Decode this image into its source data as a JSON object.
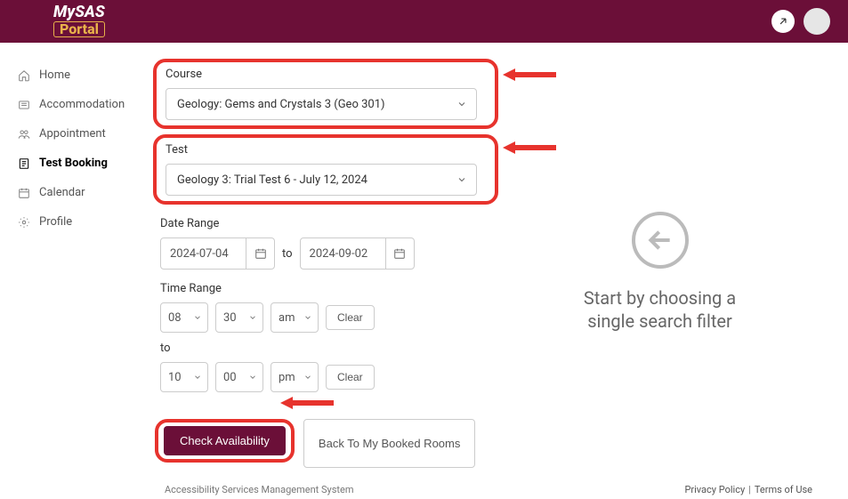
{
  "header": {
    "logo_top": "MySAS",
    "logo_bottom": "Portal"
  },
  "sidebar": {
    "items": [
      {
        "label": "Home",
        "icon": "home-icon"
      },
      {
        "label": "Accommodation",
        "icon": "accommodation-icon"
      },
      {
        "label": "Appointment",
        "icon": "appointment-icon"
      },
      {
        "label": "Test Booking",
        "icon": "test-booking-icon"
      },
      {
        "label": "Calendar",
        "icon": "calendar-icon"
      },
      {
        "label": "Profile",
        "icon": "profile-icon"
      }
    ]
  },
  "form": {
    "course_label": "Course",
    "course_value": "Geology: Gems and Crystals 3 (Geo 301)",
    "test_label": "Test",
    "test_value": "Geology 3: Trial Test 6 - July 12, 2024",
    "date_range_label": "Date Range",
    "date_from": "2024-07-04",
    "date_to_label": "to",
    "date_to": "2024-09-02",
    "time_range_label": "Time Range",
    "time_from_hr": "08",
    "time_from_min": "30",
    "time_from_ampm": "am",
    "time_to_label": "to",
    "time_to_hr": "10",
    "time_to_min": "00",
    "time_to_ampm": "pm",
    "clear_label": "Clear",
    "check_btn": "Check Availability",
    "back_btn": "Back To My Booked Rooms"
  },
  "right_panel": {
    "msg_line1": "Start by choosing a",
    "msg_line2": "single search filter"
  },
  "footer": {
    "tagline": "Accessibility Services Management System",
    "privacy": "Privacy Policy",
    "sep": " | ",
    "terms": "Terms of Use"
  }
}
